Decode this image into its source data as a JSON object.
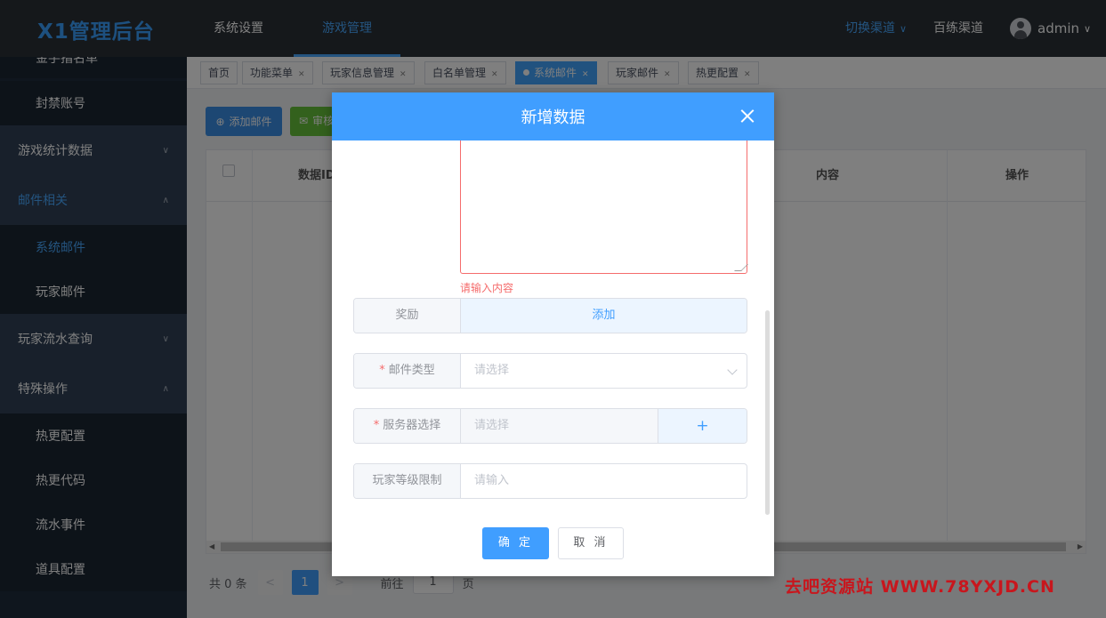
{
  "header": {
    "logo": "X1管理后台",
    "nav": [
      "系统设置",
      "游戏管理"
    ],
    "channel_switch": "切换渠道",
    "channel_name": "百练渠道",
    "username": "admin"
  },
  "sidebar": {
    "items": [
      {
        "label": "金手指名单",
        "type": "sub"
      },
      {
        "label": "封禁账号",
        "type": "sub"
      },
      {
        "label": "游戏统计数据",
        "type": "group"
      },
      {
        "label": "邮件相关",
        "type": "group",
        "active": true
      },
      {
        "label": "系统邮件",
        "type": "sub",
        "active": true
      },
      {
        "label": "玩家邮件",
        "type": "sub"
      },
      {
        "label": "玩家流水查询",
        "type": "group"
      },
      {
        "label": "特殊操作",
        "type": "group"
      },
      {
        "label": "热更配置",
        "type": "sub"
      },
      {
        "label": "热更代码",
        "type": "sub"
      },
      {
        "label": "流水事件",
        "type": "sub"
      },
      {
        "label": "道具配置",
        "type": "sub"
      }
    ]
  },
  "tabs": [
    {
      "label": "首页"
    },
    {
      "label": "功能菜单"
    },
    {
      "label": "玩家信息管理"
    },
    {
      "label": "白名单管理"
    },
    {
      "label": "系统邮件",
      "active": true
    },
    {
      "label": "玩家邮件"
    },
    {
      "label": "热更配置"
    }
  ],
  "toolbar": {
    "add_label": "添加邮件",
    "audit_label": "审核"
  },
  "table": {
    "headers": {
      "id": "数据ID",
      "content": "内容",
      "actions": "操作"
    }
  },
  "pagination": {
    "total": "共 0 条",
    "current_page": "1",
    "goto_prefix": "前往",
    "goto_value": "1",
    "goto_suffix": "页"
  },
  "dialog": {
    "title": "新增数据",
    "content_error": "请输入内容",
    "reward_label": "奖励",
    "reward_add": "添加",
    "mail_type_label": "邮件类型",
    "mail_type_placeholder": "请选择",
    "server_label": "服务器选择",
    "server_placeholder": "请选择",
    "server_add": "+",
    "level_label": "玩家等级限制",
    "level_placeholder": "请输入",
    "confirm": "确 定",
    "cancel": "取 消"
  },
  "watermark": "去吧资源站 WWW.78YXJD.CN",
  "colors": {
    "primary": "#409eff",
    "header_bg": "#2b3036",
    "sidebar_bg": "#1f2d3d",
    "error": "#f56c6c"
  }
}
